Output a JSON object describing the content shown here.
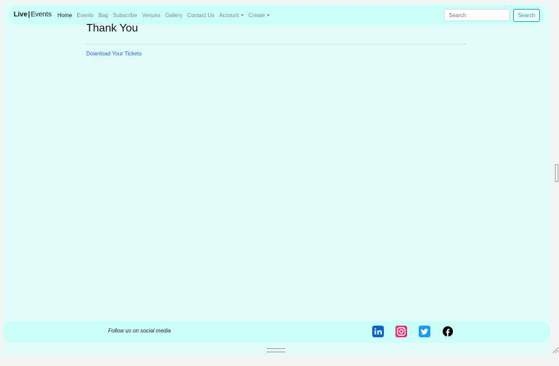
{
  "navbar": {
    "brand_left": "Live",
    "brand_sep": "|",
    "brand_right": "Events",
    "items": [
      "Home",
      "Events",
      "Bag",
      "Subscribe",
      "Venues",
      "Gallery",
      "Contact Us",
      "Account",
      "Create"
    ],
    "active": "Home",
    "search_placeholder": "Search",
    "search_button": "Search"
  },
  "main": {
    "title": "Thank You",
    "link": "Download Your Tickets"
  },
  "footer": {
    "follow": "Follow us on social media",
    "icons": [
      "linkedin-icon",
      "instagram-icon",
      "twitter-icon",
      "facebook-icon"
    ]
  },
  "colors": {
    "page_bg": "#e2fdf9",
    "bar_bg": "#ccfff7",
    "accent": "#17a2b8",
    "link": "#2563eb"
  }
}
